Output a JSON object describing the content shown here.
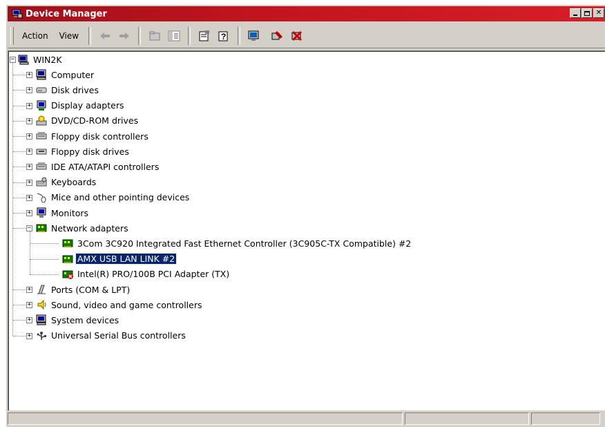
{
  "window": {
    "title": "Device Manager"
  },
  "menu": {
    "action": "Action",
    "view": "View"
  },
  "tree": {
    "root": "WIN2K",
    "categories": [
      {
        "label": "Computer",
        "icon": "computer-icon"
      },
      {
        "label": "Disk drives",
        "icon": "disk-drive-icon"
      },
      {
        "label": "Display adapters",
        "icon": "display-adapter-icon"
      },
      {
        "label": "DVD/CD-ROM drives",
        "icon": "dvd-drive-icon"
      },
      {
        "label": "Floppy disk controllers",
        "icon": "controller-icon"
      },
      {
        "label": "Floppy disk drives",
        "icon": "floppy-drive-icon"
      },
      {
        "label": "IDE ATA/ATAPI controllers",
        "icon": "controller-icon"
      },
      {
        "label": "Keyboards",
        "icon": "keyboard-icon"
      },
      {
        "label": "Mice and other pointing devices",
        "icon": "mouse-icon"
      },
      {
        "label": "Monitors",
        "icon": "monitor-icon"
      },
      {
        "label": "Network adapters",
        "icon": "network-adapter-icon"
      },
      {
        "label": "Ports (COM & LPT)",
        "icon": "port-icon"
      },
      {
        "label": "Sound, video and game controllers",
        "icon": "sound-icon"
      },
      {
        "label": "System devices",
        "icon": "system-icon"
      },
      {
        "label": "Universal Serial Bus controllers",
        "icon": "usb-icon"
      }
    ],
    "network_children": [
      {
        "label": "3Com 3C920 Integrated Fast Ethernet Controller (3C905C-TX Compatible) #2",
        "icon": "network-card-icon",
        "warning": false
      },
      {
        "label": "AMX USB LAN LINK #2",
        "icon": "network-card-icon",
        "warning": false,
        "selected": true
      },
      {
        "label": "Intel(R) PRO/100B PCI Adapter (TX)",
        "icon": "network-card-warning-icon",
        "warning": true
      }
    ]
  },
  "colors": {
    "title_bar": "#c0141e",
    "selection": "#0a246a",
    "face": "#d4d0c8"
  }
}
